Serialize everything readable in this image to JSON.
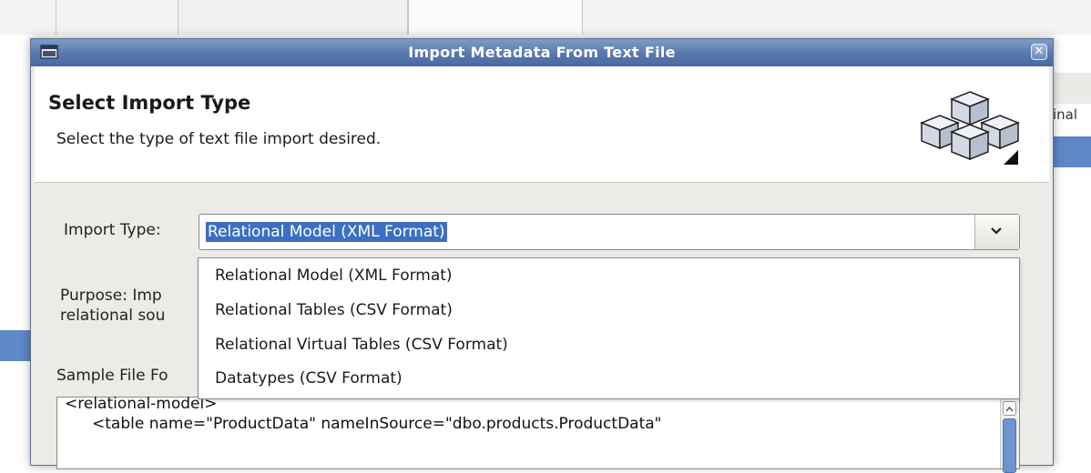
{
  "dialog": {
    "title": "Import Metadata From Text File",
    "close_icon": "close-icon"
  },
  "header": {
    "title": "Select Import Type",
    "description": "Select the type of text file import desired.",
    "icon": "cubes-icon"
  },
  "import_type": {
    "label": "Import Type:",
    "selected": "Relational Model (XML Format)",
    "options": [
      "Relational Model (XML Format)",
      "Relational Tables (CSV Format)",
      "Relational Virtual Tables (CSV Format)",
      "Datatypes (CSV Format)"
    ]
  },
  "purpose": {
    "line1": "Purpose: Imp",
    "line2": "relational sou"
  },
  "sample": {
    "label": "Sample File Fo",
    "lines": [
      "<relational-model>",
      "<table name=\"ProductData\" nameInSource=\"dbo.products.ProductData\""
    ]
  },
  "background": {
    "right_label": "inal"
  },
  "colors": {
    "titlebar": "#5878ad",
    "selection": "#3c6fc4",
    "scroll_thumb": "#6e94cf"
  }
}
